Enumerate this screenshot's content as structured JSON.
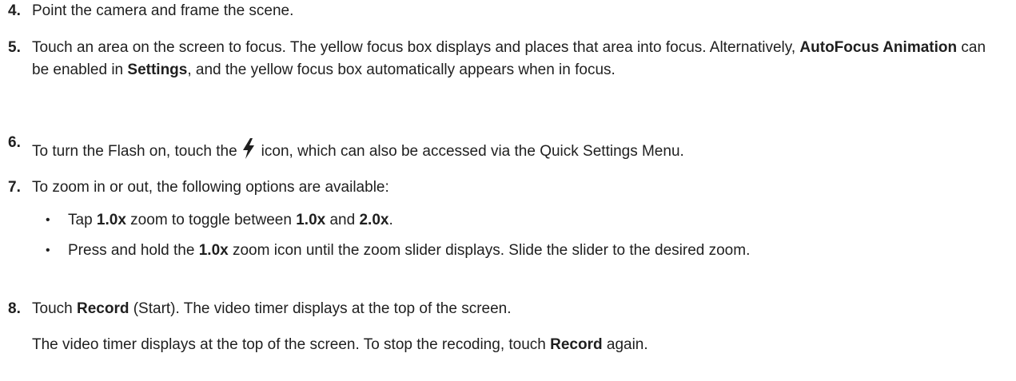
{
  "steps": [
    {
      "num": "4.",
      "text": "Point the camera and frame the scene."
    },
    {
      "num": "5.",
      "text_a": "Touch an area on the screen to focus. The yellow focus box displays and places that area into focus. Alternatively, ",
      "bold_a": "AutoFocus Animation",
      "text_b": " can be enabled in ",
      "bold_b": "Settings",
      "text_c": ", and the yellow focus box automatically appears when in focus."
    },
    {
      "num": "6.",
      "text_a": "To turn the Flash on, touch the",
      "icon": "flash-icon",
      "text_b": "icon, which can also be accessed via the Quick Settings Menu."
    },
    {
      "num": "7.",
      "text": "To zoom in or out, the following options are available:",
      "bullets": [
        {
          "t1": "Tap ",
          "b1": "1.0x",
          "t2": " zoom to toggle between ",
          "b2": "1.0x",
          "t3": " and ",
          "b3": "2.0x",
          "t4": "."
        },
        {
          "t1": "Press and hold the ",
          "b1": "1.0x",
          "t2": " zoom icon until the zoom slider displays. Slide the slider to the desired zoom."
        }
      ]
    },
    {
      "num": "8.",
      "text_a": "Touch ",
      "bold_a": "Record",
      "text_b": " (Start). The video timer displays at the top of the screen.",
      "note_a": "The video timer displays at the top of the screen. To stop the recoding, touch ",
      "note_bold": "Record",
      "note_b": " again."
    }
  ],
  "bullet_char": "•"
}
